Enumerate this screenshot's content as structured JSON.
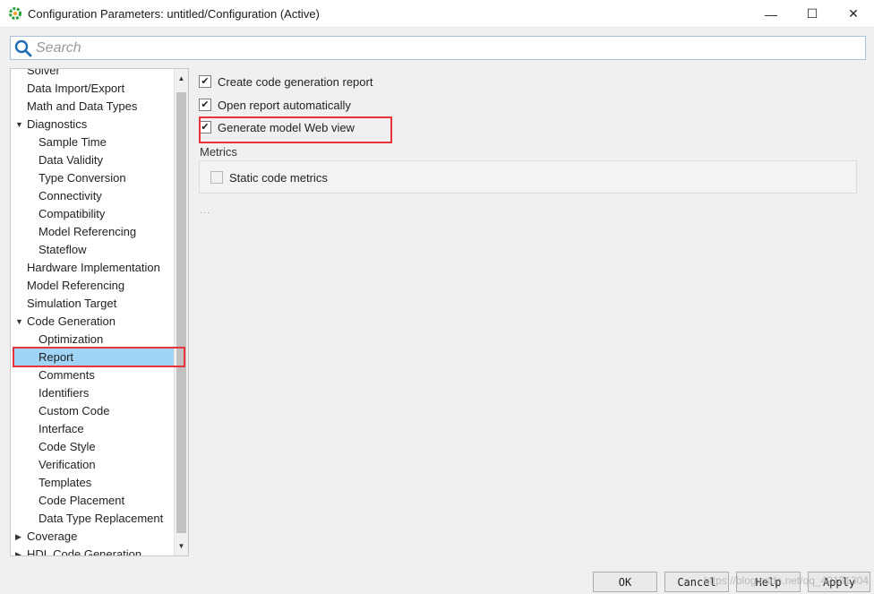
{
  "window": {
    "title": "Configuration Parameters: untitled/Configuration (Active)",
    "controls": {
      "minimize": "—",
      "maximize": "☐",
      "close": "✕"
    }
  },
  "search": {
    "placeholder": "Search",
    "value": ""
  },
  "tree": {
    "items": [
      {
        "label": "Solver",
        "level": 0
      },
      {
        "label": "Data Import/Export",
        "level": 0
      },
      {
        "label": "Math and Data Types",
        "level": 0
      },
      {
        "label": "Diagnostics",
        "level": 0,
        "expanded": true
      },
      {
        "label": "Sample Time",
        "level": 1
      },
      {
        "label": "Data Validity",
        "level": 1
      },
      {
        "label": "Type Conversion",
        "level": 1
      },
      {
        "label": "Connectivity",
        "level": 1
      },
      {
        "label": "Compatibility",
        "level": 1
      },
      {
        "label": "Model Referencing",
        "level": 1
      },
      {
        "label": "Stateflow",
        "level": 1
      },
      {
        "label": "Hardware Implementation",
        "level": 0
      },
      {
        "label": "Model Referencing",
        "level": 0
      },
      {
        "label": "Simulation Target",
        "level": 0
      },
      {
        "label": "Code Generation",
        "level": 0,
        "expanded": true
      },
      {
        "label": "Optimization",
        "level": 1
      },
      {
        "label": "Report",
        "level": 1,
        "selected": true
      },
      {
        "label": "Comments",
        "level": 1
      },
      {
        "label": "Identifiers",
        "level": 1
      },
      {
        "label": "Custom Code",
        "level": 1
      },
      {
        "label": "Interface",
        "level": 1
      },
      {
        "label": "Code Style",
        "level": 1
      },
      {
        "label": "Verification",
        "level": 1
      },
      {
        "label": "Templates",
        "level": 1
      },
      {
        "label": "Code Placement",
        "level": 1
      },
      {
        "label": "Data Type Replacement",
        "level": 1
      },
      {
        "label": "Coverage",
        "level": 0,
        "expanded": false
      },
      {
        "label": "HDL Code Generation",
        "level": 0,
        "expanded": false
      }
    ]
  },
  "report": {
    "create_report": {
      "label": "Create code generation report",
      "checked": true
    },
    "open_report": {
      "label": "Open report automatically",
      "checked": true
    },
    "web_view": {
      "label": "Generate model Web view",
      "checked": true
    },
    "metrics_title": "Metrics",
    "static_metrics": {
      "label": "Static code metrics",
      "checked": false
    },
    "more": "..."
  },
  "buttons": {
    "ok": "OK",
    "cancel": "Cancel",
    "help": "Help",
    "apply": "Apply"
  },
  "watermark": "https://blog.csdn.net/qq_42151304",
  "colors": {
    "selection": "#9fd4f7",
    "highlight_box": "#e8343a",
    "search_icon": "#1f6fb5"
  }
}
